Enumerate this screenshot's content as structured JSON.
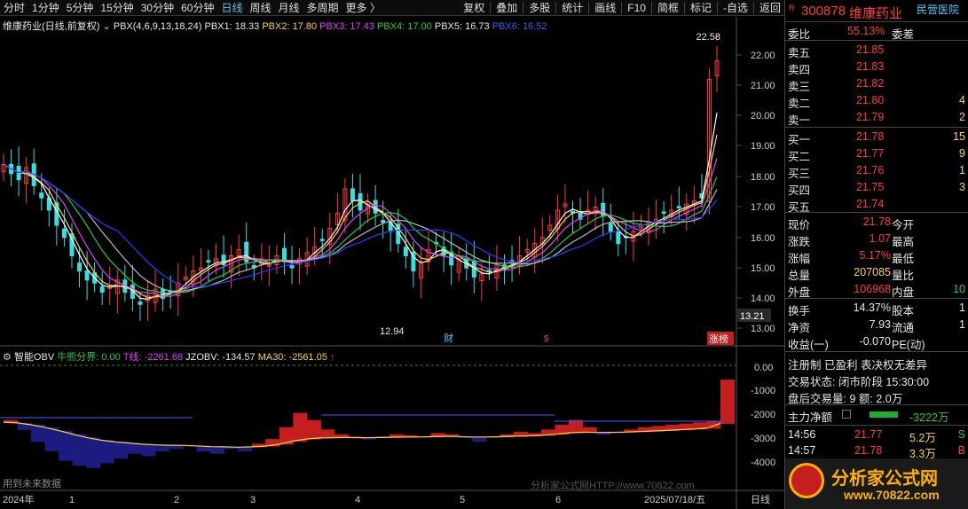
{
  "toolbar": {
    "items": [
      "分时",
      "1分钟",
      "5分钟",
      "15分钟",
      "30分钟",
      "60分钟",
      "日线",
      "周线",
      "月线",
      "多周期",
      "更多 〉"
    ],
    "right": [
      "复权",
      "叠加",
      "多股",
      "统计",
      "画线",
      "F10",
      "简框",
      "标记",
      "-自选",
      "返回"
    ]
  },
  "indicators": {
    "name": "维康药业(日线,前复权)",
    "pbx": "PBX(4,6,9,13,18,24)",
    "pbx1": "PBX1: 18.33",
    "pbx2": "PBX2: 17.80",
    "pbx3": "PBX3: 17.43",
    "pbx4": "PBX4: 17.00",
    "pbx5": "PBX5: 16.73",
    "pbx6": "PBX6: 16.52"
  },
  "obv": {
    "name": "智能OBV",
    "bull": "牛熊分界: 0.00",
    "t": "T线: -2261.68",
    "jz": "JZOBV: -134.57",
    "ma": "MA30: -2561.05",
    "note": "用到未来数据",
    "watermark": "分析家公式网HTTP://www.70822.com"
  },
  "price_axis": [
    "22.00",
    "21.00",
    "20.00",
    "19.00",
    "18.00",
    "17.00",
    "16.00",
    "15.00",
    "14.00",
    "13.00"
  ],
  "obv_axis": [
    "0.00",
    "-1000",
    "-2000",
    "-3000",
    "-4000"
  ],
  "labels": {
    "hi": "22.58",
    "lo": "12.94",
    "last": "13.21",
    "cai": "财",
    "s": "$",
    "zhang": "涨榜",
    "rizhou": "日线"
  },
  "dates": [
    "2024年",
    "1",
    "2",
    "3",
    "4",
    "5",
    "6",
    "2025/07/18/五"
  ],
  "stock": {
    "flag": "R",
    "code": "300878",
    "name": "维康药业",
    "tag": "民营医院"
  },
  "weibi": {
    "label": "委比",
    "value": "55.13%",
    "label2": "委差"
  },
  "sells": [
    {
      "l": "卖五",
      "p": "21.85",
      "v": ""
    },
    {
      "l": "卖四",
      "p": "21.83",
      "v": ""
    },
    {
      "l": "卖三",
      "p": "21.82",
      "v": ""
    },
    {
      "l": "卖二",
      "p": "21.80",
      "v": "4"
    },
    {
      "l": "卖一",
      "p": "21.79",
      "v": "2"
    }
  ],
  "buys": [
    {
      "l": "买一",
      "p": "21.78",
      "v": "15"
    },
    {
      "l": "买二",
      "p": "21.77",
      "v": "9"
    },
    {
      "l": "买三",
      "p": "21.76",
      "v": "1"
    },
    {
      "l": "买四",
      "p": "21.75",
      "v": "3"
    },
    {
      "l": "买五",
      "p": "21.74",
      "v": ""
    }
  ],
  "quote": [
    {
      "a": "现价",
      "b": "21.78",
      "c": "今开"
    },
    {
      "a": "涨跌",
      "b": "1.07",
      "c": "最高"
    },
    {
      "a": "涨幅",
      "b": "5.17%",
      "c": "最低"
    },
    {
      "a": "总量",
      "b": "207085",
      "c": "量比"
    },
    {
      "a": "外盘",
      "b": "106968",
      "c": "内盘",
      "d": "10"
    }
  ],
  "fin": [
    {
      "a": "换手",
      "b": "14.37%",
      "c": "股本",
      "d": "1"
    },
    {
      "a": "净资",
      "b": "7.93",
      "c": "流通",
      "d": "1"
    },
    {
      "a": "收益(一)",
      "b": "-0.070",
      "c": "PE(动)",
      "d": ""
    }
  ],
  "info": [
    "注册制 已盈利 表决权无差异",
    "交易状态: 闭市阶段 15:30:00",
    "盘后交易量: 9 额: 2.0万"
  ],
  "flow": {
    "label": "主力净额",
    "value": "-3222万"
  },
  "ticks": [
    {
      "t": "14:56",
      "p": "21.77",
      "v": "5.2万",
      "s": "S"
    },
    {
      "t": "14:57",
      "p": "21.78",
      "v": "3.3万",
      "s": "B"
    }
  ],
  "logo": {
    "text": "分析家公式网",
    "url": "www.70822.com"
  },
  "colors": {
    "up": "#ff3b3b",
    "down": "#34e0e0",
    "ma": "#1e2bff"
  }
}
